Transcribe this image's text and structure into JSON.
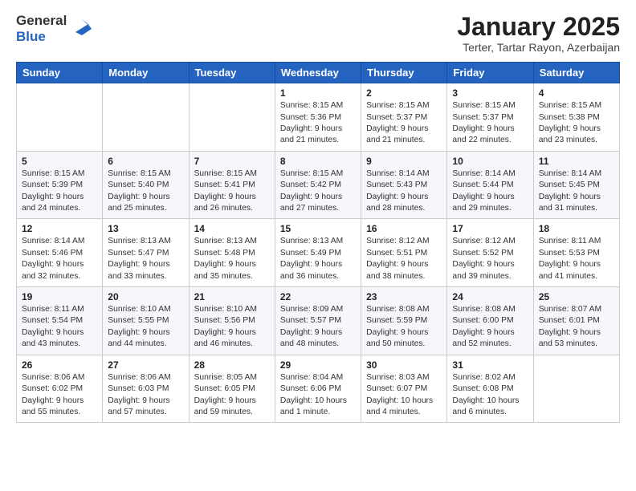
{
  "header": {
    "logo_general": "General",
    "logo_blue": "Blue",
    "month_title": "January 2025",
    "location": "Terter, Tartar Rayon, Azerbaijan"
  },
  "days_of_week": [
    "Sunday",
    "Monday",
    "Tuesday",
    "Wednesday",
    "Thursday",
    "Friday",
    "Saturday"
  ],
  "weeks": [
    [
      {
        "day": "",
        "info": ""
      },
      {
        "day": "",
        "info": ""
      },
      {
        "day": "",
        "info": ""
      },
      {
        "day": "1",
        "info": "Sunrise: 8:15 AM\nSunset: 5:36 PM\nDaylight: 9 hours\nand 21 minutes."
      },
      {
        "day": "2",
        "info": "Sunrise: 8:15 AM\nSunset: 5:37 PM\nDaylight: 9 hours\nand 21 minutes."
      },
      {
        "day": "3",
        "info": "Sunrise: 8:15 AM\nSunset: 5:37 PM\nDaylight: 9 hours\nand 22 minutes."
      },
      {
        "day": "4",
        "info": "Sunrise: 8:15 AM\nSunset: 5:38 PM\nDaylight: 9 hours\nand 23 minutes."
      }
    ],
    [
      {
        "day": "5",
        "info": "Sunrise: 8:15 AM\nSunset: 5:39 PM\nDaylight: 9 hours\nand 24 minutes."
      },
      {
        "day": "6",
        "info": "Sunrise: 8:15 AM\nSunset: 5:40 PM\nDaylight: 9 hours\nand 25 minutes."
      },
      {
        "day": "7",
        "info": "Sunrise: 8:15 AM\nSunset: 5:41 PM\nDaylight: 9 hours\nand 26 minutes."
      },
      {
        "day": "8",
        "info": "Sunrise: 8:15 AM\nSunset: 5:42 PM\nDaylight: 9 hours\nand 27 minutes."
      },
      {
        "day": "9",
        "info": "Sunrise: 8:14 AM\nSunset: 5:43 PM\nDaylight: 9 hours\nand 28 minutes."
      },
      {
        "day": "10",
        "info": "Sunrise: 8:14 AM\nSunset: 5:44 PM\nDaylight: 9 hours\nand 29 minutes."
      },
      {
        "day": "11",
        "info": "Sunrise: 8:14 AM\nSunset: 5:45 PM\nDaylight: 9 hours\nand 31 minutes."
      }
    ],
    [
      {
        "day": "12",
        "info": "Sunrise: 8:14 AM\nSunset: 5:46 PM\nDaylight: 9 hours\nand 32 minutes."
      },
      {
        "day": "13",
        "info": "Sunrise: 8:13 AM\nSunset: 5:47 PM\nDaylight: 9 hours\nand 33 minutes."
      },
      {
        "day": "14",
        "info": "Sunrise: 8:13 AM\nSunset: 5:48 PM\nDaylight: 9 hours\nand 35 minutes."
      },
      {
        "day": "15",
        "info": "Sunrise: 8:13 AM\nSunset: 5:49 PM\nDaylight: 9 hours\nand 36 minutes."
      },
      {
        "day": "16",
        "info": "Sunrise: 8:12 AM\nSunset: 5:51 PM\nDaylight: 9 hours\nand 38 minutes."
      },
      {
        "day": "17",
        "info": "Sunrise: 8:12 AM\nSunset: 5:52 PM\nDaylight: 9 hours\nand 39 minutes."
      },
      {
        "day": "18",
        "info": "Sunrise: 8:11 AM\nSunset: 5:53 PM\nDaylight: 9 hours\nand 41 minutes."
      }
    ],
    [
      {
        "day": "19",
        "info": "Sunrise: 8:11 AM\nSunset: 5:54 PM\nDaylight: 9 hours\nand 43 minutes."
      },
      {
        "day": "20",
        "info": "Sunrise: 8:10 AM\nSunset: 5:55 PM\nDaylight: 9 hours\nand 44 minutes."
      },
      {
        "day": "21",
        "info": "Sunrise: 8:10 AM\nSunset: 5:56 PM\nDaylight: 9 hours\nand 46 minutes."
      },
      {
        "day": "22",
        "info": "Sunrise: 8:09 AM\nSunset: 5:57 PM\nDaylight: 9 hours\nand 48 minutes."
      },
      {
        "day": "23",
        "info": "Sunrise: 8:08 AM\nSunset: 5:59 PM\nDaylight: 9 hours\nand 50 minutes."
      },
      {
        "day": "24",
        "info": "Sunrise: 8:08 AM\nSunset: 6:00 PM\nDaylight: 9 hours\nand 52 minutes."
      },
      {
        "day": "25",
        "info": "Sunrise: 8:07 AM\nSunset: 6:01 PM\nDaylight: 9 hours\nand 53 minutes."
      }
    ],
    [
      {
        "day": "26",
        "info": "Sunrise: 8:06 AM\nSunset: 6:02 PM\nDaylight: 9 hours\nand 55 minutes."
      },
      {
        "day": "27",
        "info": "Sunrise: 8:06 AM\nSunset: 6:03 PM\nDaylight: 9 hours\nand 57 minutes."
      },
      {
        "day": "28",
        "info": "Sunrise: 8:05 AM\nSunset: 6:05 PM\nDaylight: 9 hours\nand 59 minutes."
      },
      {
        "day": "29",
        "info": "Sunrise: 8:04 AM\nSunset: 6:06 PM\nDaylight: 10 hours\nand 1 minute."
      },
      {
        "day": "30",
        "info": "Sunrise: 8:03 AM\nSunset: 6:07 PM\nDaylight: 10 hours\nand 4 minutes."
      },
      {
        "day": "31",
        "info": "Sunrise: 8:02 AM\nSunset: 6:08 PM\nDaylight: 10 hours\nand 6 minutes."
      },
      {
        "day": "",
        "info": ""
      }
    ]
  ]
}
